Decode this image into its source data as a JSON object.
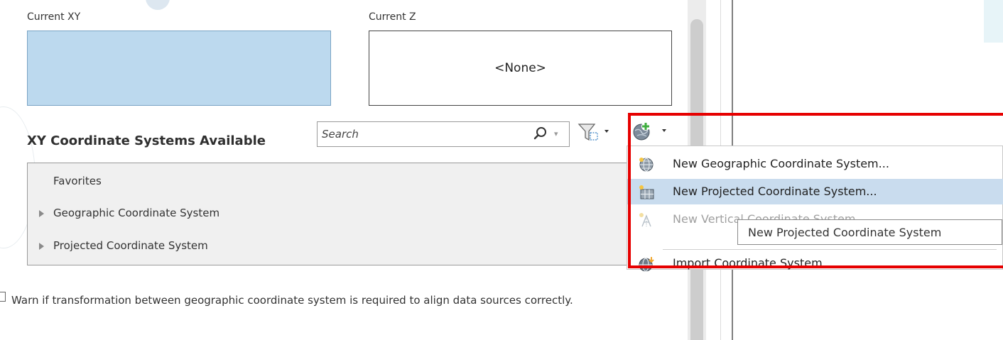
{
  "current_xy": {
    "label": "Current XY"
  },
  "current_z": {
    "label": "Current Z",
    "value": "<None>"
  },
  "available": {
    "title": "XY Coordinate Systems Available",
    "search_placeholder": "Search",
    "filter_icon": "filter-icon",
    "add_icon": "globe-add-icon"
  },
  "tree": {
    "items": [
      {
        "label": "Favorites",
        "expandable": false
      },
      {
        "label": "Geographic Coordinate System",
        "expandable": true
      },
      {
        "label": "Projected Coordinate System",
        "expandable": true
      }
    ]
  },
  "menu": {
    "items": [
      {
        "label": "New Geographic Coordinate System...",
        "icon": "geographic-globe-icon",
        "state": "normal"
      },
      {
        "label": "New Projected Coordinate System...",
        "icon": "projected-grid-icon",
        "state": "highlighted"
      },
      {
        "label": "New Vertical Coordinate System...",
        "icon": "vertical-icon",
        "state": "disabled"
      },
      {
        "label": "Import Coordinate System...",
        "icon": "import-globe-icon",
        "state": "normal"
      }
    ]
  },
  "tooltip": {
    "text": "New Projected Coordinate System"
  },
  "warning": {
    "checked": false,
    "text": "Warn if transformation between geographic coordinate system is required to align data sources correctly."
  },
  "colors": {
    "xy_box": "#bcd9ee",
    "menu_highlight": "#c9dcee",
    "annotation_frame": "#e60000"
  }
}
